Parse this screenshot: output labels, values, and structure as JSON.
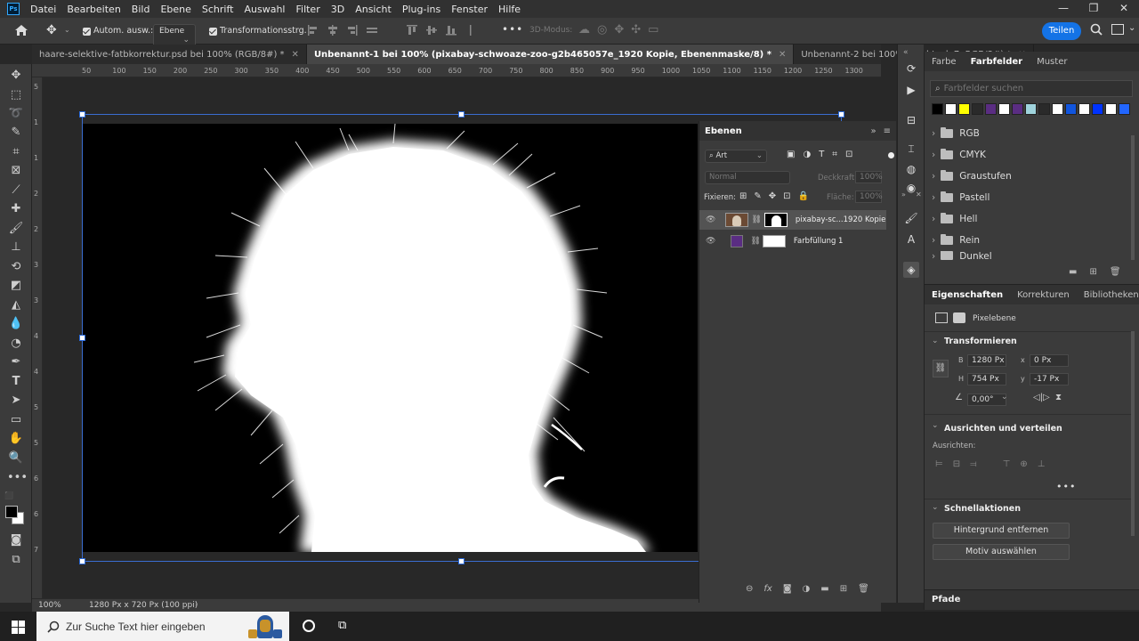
{
  "menubar": {
    "app_logo": "Ps",
    "items": [
      "Datei",
      "Bearbeiten",
      "Bild",
      "Ebene",
      "Schrift",
      "Auswahl",
      "Filter",
      "3D",
      "Ansicht",
      "Plug-ins",
      "Fenster",
      "Hilfe"
    ]
  },
  "optionsbar": {
    "auto_select_label": "Autom. ausw.:",
    "auto_select_value": "Ebene",
    "transform_label": "Transformationsstrg.",
    "mode_3d": "3D-Modus:",
    "more": "•••",
    "share_button": "Teilen"
  },
  "tabs": [
    {
      "label": "haare-selektive-fatbkorrektur.psd bei 100% (RGB/8#) *",
      "active": false
    },
    {
      "label": "Unbenannt-1 bei 100% (pixabay-schwoaze-zoo-g2b465057e_1920 Kopie, Ebenenmaske/8) *",
      "active": true
    },
    {
      "label": "Unbenannt-2 bei 100% (Rechteck 7, RGB/8#) *",
      "active": false
    }
  ],
  "ruler": {
    "h": [
      "50",
      "100",
      "150",
      "200",
      "250",
      "300",
      "350",
      "400",
      "450",
      "500",
      "550",
      "600",
      "650",
      "700",
      "750",
      "800",
      "850",
      "900",
      "950",
      "1000",
      "1050",
      "1100",
      "1150",
      "1200",
      "1250",
      "1300"
    ],
    "v": [
      "5",
      "1",
      "1",
      "2",
      "2",
      "3",
      "3",
      "4",
      "4",
      "5",
      "5",
      "6",
      "6",
      "7"
    ]
  },
  "statusbar": {
    "zoom": "100%",
    "doc_info": "1280 Px x 720 Px (100 ppi)"
  },
  "layers_panel": {
    "title": "Ebenen",
    "filter_kind": "Art",
    "blend_mode": "Normal",
    "opacity_label": "Deckkraft:",
    "opacity_value": "100%",
    "lock_label": "Fixieren:",
    "fill_label": "Fläche:",
    "fill_value": "100%",
    "layers": [
      {
        "name": "pixabay-sc...1920 Kopie",
        "selected": true,
        "thumb_color": "#6b4a34"
      },
      {
        "name": "Farbfüllung 1",
        "selected": false,
        "thumb_color": "#5a2d82"
      }
    ]
  },
  "swatches_panel": {
    "tabs": [
      "Farbe",
      "Farbfelder",
      "Muster"
    ],
    "active_tab": "Farbfelder",
    "search_placeholder": "Farbfelder suchen",
    "recent_colors": [
      "#000000",
      "#ffffff",
      "#ffff00",
      "#2a2a2a",
      "#5a2d82",
      "#ffffff",
      "#5a2d82",
      "#9fd3dc",
      "#2a2a2a",
      "#ffffff",
      "#1155dd",
      "#ffffff",
      "#0033ff",
      "#ffffff",
      "#2266ff"
    ],
    "folders": [
      "RGB",
      "CMYK",
      "Graustufen",
      "Pastell",
      "Hell",
      "Rein",
      "Dunkel"
    ]
  },
  "properties_panel": {
    "tabs": [
      "Eigenschaften",
      "Korrekturen",
      "Bibliotheken"
    ],
    "active_tab": "Eigenschaften",
    "kind": "Pixelebene",
    "transform_title": "Transformieren",
    "w_label": "B",
    "w_value": "1280 Px",
    "h_label": "H",
    "h_value": "754 Px",
    "x_label": "x",
    "x_value": "0 Px",
    "y_label": "y",
    "y_value": "-17 Px",
    "angle_value": "0,00°",
    "align_title": "Ausrichten und verteilen",
    "align_label": "Ausrichten:",
    "quick_title": "Schnellaktionen",
    "quick_buttons": [
      "Hintergrund entfernen",
      "Motiv auswählen"
    ],
    "paths_title": "Pfade"
  },
  "taskbar": {
    "search_placeholder": "Zur Suche Text hier eingeben"
  }
}
